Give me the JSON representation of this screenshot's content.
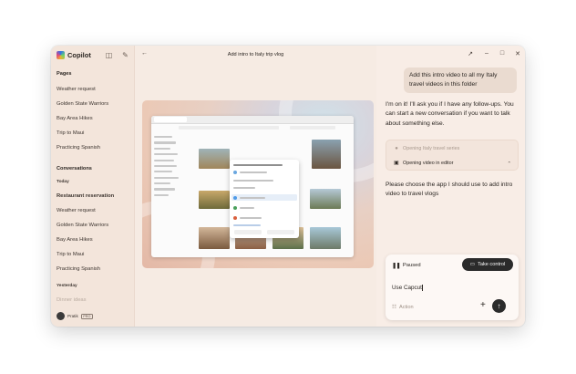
{
  "app": {
    "name": "Copilot"
  },
  "sidebar": {
    "pages_heading": "Pages",
    "pages": [
      "Weather request",
      "Golden State Warriors",
      "Bay Area Hikes",
      "Trip to Maui",
      "Practicing Spanish"
    ],
    "conversations_heading": "Conversations",
    "today_label": "Today",
    "today_items": [
      "Restaurant reservation",
      "Weather request",
      "Golden State Warriors",
      "Bay Area Hikes",
      "Trip to Maui",
      "Practicing Spanish"
    ],
    "yesterday_label": "Yesterday",
    "yesterday_items": [
      "Dinner ideas"
    ],
    "user": {
      "name": "Pratik",
      "badge": "PRO"
    }
  },
  "main": {
    "title": "Add intro to Italy trip vlog"
  },
  "chat": {
    "user_message": "Add this intro video to all my Italy travel videos in this folder",
    "reply_1": "I'm on it! I'll ask you if I have any follow-ups. You can start a new conversation if you want to talk about something else.",
    "steps": [
      {
        "label": "Opening Italy travel series",
        "icon": "dot-icon",
        "state": "done"
      },
      {
        "label": "Opening video in editor",
        "icon": "video-icon",
        "state": "active"
      }
    ],
    "reply_2": "Please choose the app I should use to add intro video to travel vlogs",
    "composer": {
      "status": "Paused",
      "take_control": "Take control",
      "input_value": "Use Capcut",
      "action_label": "Action"
    }
  },
  "colors": {
    "accent_dark": "#2b2b2b",
    "window_bg": "#f7ece4",
    "sidebar_bg": "#f3e5db"
  }
}
